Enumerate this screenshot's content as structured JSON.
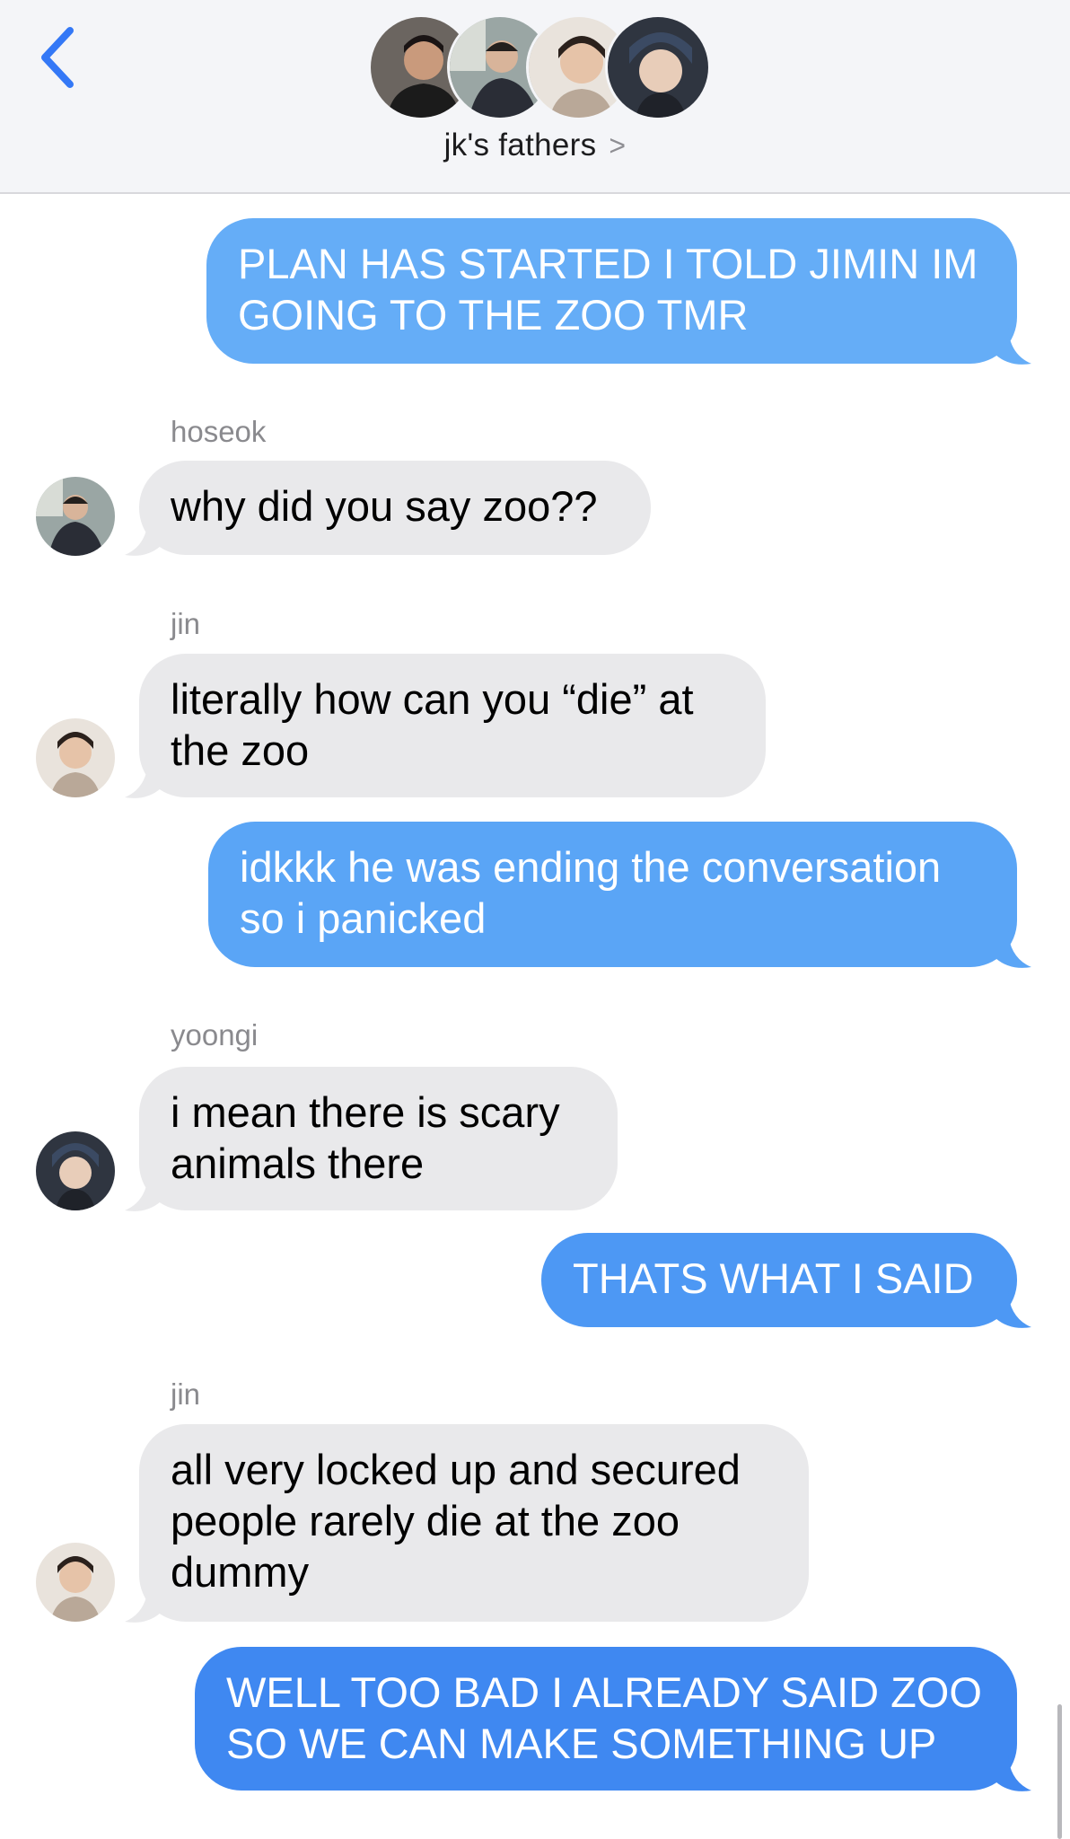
{
  "header": {
    "group_name": "jk's fathers",
    "chevron": ">",
    "back_icon": "chevron-left-icon",
    "accent": "#3478f6"
  },
  "messages": [
    {
      "from": "me",
      "text": "PLAN HAS STARTED I TOLD JIMIN IM GOING TO THE ZOO TMR"
    },
    {
      "from": "hoseok",
      "sender": "hoseok",
      "text": "why did you say zoo??"
    },
    {
      "from": "jin",
      "sender": "jin",
      "text": "literally how can you “die” at the zoo"
    },
    {
      "from": "me",
      "text": "idkkk he was ending the conversation so i panicked"
    },
    {
      "from": "yoongi",
      "sender": "yoongi",
      "text": "i mean there is scary animals there"
    },
    {
      "from": "me",
      "text": "THATS WHAT I SAID"
    },
    {
      "from": "jin",
      "sender": "jin",
      "text": "all very locked up and secured people rarely die at the zoo dummy"
    },
    {
      "from": "me",
      "text": "WELL TOO BAD I ALREADY SAID ZOO SO WE CAN MAKE SOMETHING UP"
    }
  ],
  "colors": {
    "outgoing_bubble_top": "#6ab3f8",
    "outgoing_bubble_bottom": "#3e86f0",
    "incoming_bubble": "#e9e9eb",
    "header_bg": "#f4f5f8"
  }
}
